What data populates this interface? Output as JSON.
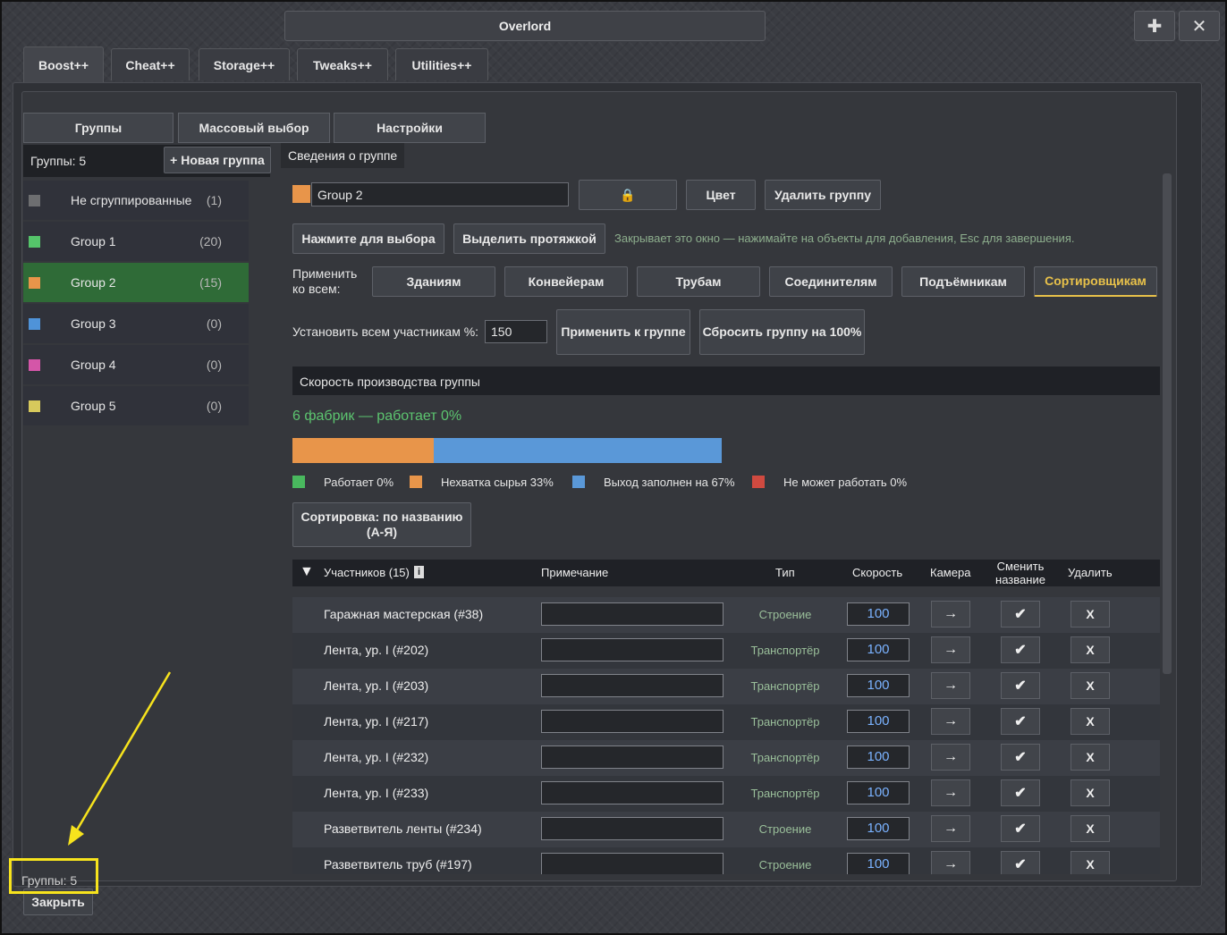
{
  "window": {
    "title": "Overlord",
    "pin_icon": "pin-icon",
    "close_icon": "close-icon"
  },
  "tabs": [
    "Boost++",
    "Cheat++",
    "Storage++",
    "Tweaks++",
    "Utilities++"
  ],
  "subtabs": [
    "Группы",
    "Массовый выбор",
    "Настройки"
  ],
  "groups_header": {
    "count_label": "Группы: 5",
    "new_group_label": "+ Новая группа"
  },
  "groups": [
    {
      "name": "Не сгруппированные",
      "count": "(1)",
      "color": "#6d6e70"
    },
    {
      "name": "Group 1",
      "count": "(20)",
      "color": "#55c46a"
    },
    {
      "name": "Group 2",
      "count": "(15)",
      "color": "#e8954a"
    },
    {
      "name": "Group 3",
      "count": "(0)",
      "color": "#4f93d9"
    },
    {
      "name": "Group 4",
      "count": "(0)",
      "color": "#d456a8"
    },
    {
      "name": "Group 5",
      "count": "(0)",
      "color": "#d7c95c"
    }
  ],
  "info": {
    "tab_label": "Сведения о группе",
    "group_name": "Group 2",
    "lock_icon": "🔒",
    "color_label": "Цвет",
    "delete_label": "Удалить группу",
    "click_select_label": "Нажмите для выбора",
    "drag_select_label": "Выделить протяжкой",
    "hint": "Закрывает это окно — нажимайте на объекты для добавления, Esc для завершения.",
    "apply_all_label": "Применить ко всем:",
    "apply_buttons": [
      "Зданиям",
      "Конвейерам",
      "Трубам",
      "Соединителям",
      "Подъёмникам",
      "Сортировщикам"
    ],
    "set_all_label": "Установить всем участникам %:",
    "set_all_value": "150",
    "apply_group_label": "Применить к группе",
    "reset_group_label": "Сбросить группу на 100%"
  },
  "production": {
    "header": "Скорость производства группы",
    "summary": "6 фабрик — работает 0%",
    "bar": {
      "working": 0,
      "shortage": 33,
      "full": 67,
      "blocked": 0
    },
    "legend": [
      {
        "label": "Работает 0%",
        "color": "#49b85e"
      },
      {
        "label": "Нехватка сырья 33%",
        "color": "#e8954a"
      },
      {
        "label": "Выход заполнен на 67%",
        "color": "#5a98d8"
      },
      {
        "label": "Не может работать 0%",
        "color": "#d04a40"
      }
    ]
  },
  "sort_label": "Сортировка: по названию (А-Я)",
  "table": {
    "headers": {
      "members": "Участников (15)",
      "note": "Примечание",
      "type": "Тип",
      "speed": "Скорость",
      "camera": "Камера",
      "rename": "Сменить название",
      "delete": "Удалить"
    },
    "rows": [
      {
        "name": "Гаражная мастерская (#38)",
        "type": "Строение",
        "speed": "100"
      },
      {
        "name": "Лента, ур. I (#202)",
        "type": "Транспортёр",
        "speed": "100"
      },
      {
        "name": "Лента, ур. I (#203)",
        "type": "Транспортёр",
        "speed": "100"
      },
      {
        "name": "Лента, ур. I (#217)",
        "type": "Транспортёр",
        "speed": "100"
      },
      {
        "name": "Лента, ур. I (#232)",
        "type": "Транспортёр",
        "speed": "100"
      },
      {
        "name": "Лента, ур. I (#233)",
        "type": "Транспортёр",
        "speed": "100"
      },
      {
        "name": "Разветвитель ленты (#234)",
        "type": "Строение",
        "speed": "100"
      },
      {
        "name": "Разветвитель труб (#197)",
        "type": "Строение",
        "speed": "100"
      }
    ]
  },
  "footer": {
    "count_label": "Группы: 5",
    "close_label": "Закрыть"
  }
}
